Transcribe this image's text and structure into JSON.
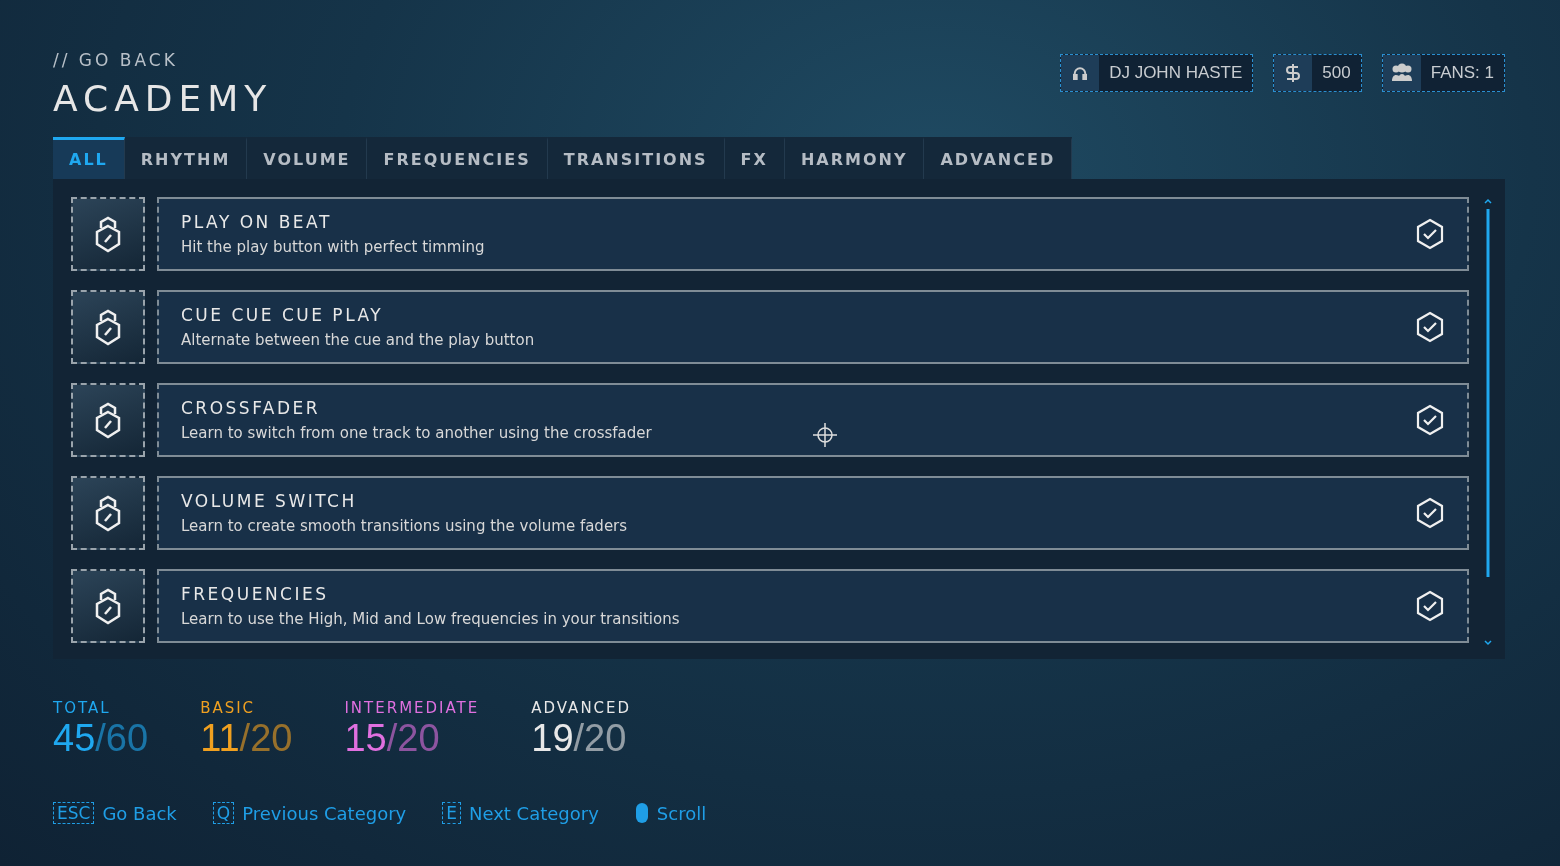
{
  "header": {
    "back": "// GO BACK",
    "title": "ACADEMY"
  },
  "profile": [
    {
      "kind": "headphones",
      "label": "DJ JOHN HASTE"
    },
    {
      "kind": "money",
      "label": "500"
    },
    {
      "kind": "people",
      "label": "FANS: 1"
    }
  ],
  "tabs": [
    {
      "label": "ALL",
      "selected": true
    },
    {
      "label": "RHYTHM",
      "selected": false
    },
    {
      "label": "VOLUME",
      "selected": false
    },
    {
      "label": "FREQUENCIES",
      "selected": false
    },
    {
      "label": "TRANSITIONS",
      "selected": false
    },
    {
      "label": "FX",
      "selected": false
    },
    {
      "label": "HARMONY",
      "selected": false
    },
    {
      "label": "ADVANCED",
      "selected": false
    }
  ],
  "lessons": [
    {
      "title": "PLAY ON BEAT",
      "description": "Hit the play button with perfect timming",
      "completed": true
    },
    {
      "title": "CUE CUE CUE PLAY",
      "description": "Alternate between the cue and the play button",
      "completed": true
    },
    {
      "title": "CROSSFADER",
      "description": "Learn to switch from one track to another using the crossfader",
      "completed": true
    },
    {
      "title": "VOLUME SWITCH",
      "description": "Learn to create smooth transitions using the volume faders",
      "completed": true
    },
    {
      "title": "FREQUENCIES",
      "description": "Learn to use the High, Mid and Low frequencies in your transitions",
      "completed": true
    }
  ],
  "stats": [
    {
      "label": "TOTAL",
      "value": "45",
      "separator": "/",
      "total": "60",
      "color": "#1fa8f0"
    },
    {
      "label": "BASIC",
      "value": "11",
      "separator": "/",
      "total": "20",
      "color": "#f0a020"
    },
    {
      "label": "INTERMEDIATE",
      "value": "15",
      "separator": "/",
      "total": "20",
      "color": "#e070e0"
    },
    {
      "label": "ADVANCED",
      "value": "19",
      "separator": "/",
      "total": "20",
      "color": "#e8e8e8"
    }
  ],
  "hints": [
    {
      "kind": "key",
      "key": "ESC",
      "label": "Go Back"
    },
    {
      "kind": "key",
      "key": "Q",
      "label": "Previous Category"
    },
    {
      "kind": "key",
      "key": "E",
      "label": "Next Category"
    },
    {
      "kind": "mouse",
      "label": "Scroll"
    }
  ]
}
